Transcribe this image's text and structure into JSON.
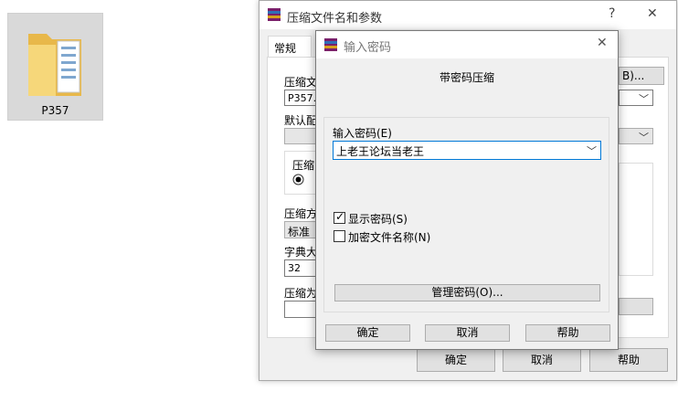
{
  "desktop": {
    "folder_label": "P357"
  },
  "back_dialog": {
    "title": "压缩文件名和参数",
    "help_symbol": "?",
    "close_symbol": "✕",
    "tab_general": "常规",
    "label_archive_name": "压缩文",
    "archive_name_value": "P357.r",
    "browse_button_partial": "B)...",
    "label_default_profile": "默认配",
    "label_update_partial": "压缩",
    "label_method": "压缩方",
    "method_value": "标准",
    "label_dictionary": "字典大",
    "dictionary_value": "32",
    "label_volume": "压缩为",
    "ok_button": "确定",
    "cancel_button": "取消",
    "help_button": "帮助"
  },
  "front_dialog": {
    "title": "输入密码",
    "close_symbol": "✕",
    "heading": "带密码压缩",
    "label_enter_password": "输入密码(E)",
    "password_value": "上老王论坛当老王",
    "show_password_label": "显示密码(S)",
    "show_password_checked": true,
    "encrypt_names_label": "加密文件名称(N)",
    "encrypt_names_checked": false,
    "manage_passwords_button": "管理密码(O)...",
    "ok_button": "确定",
    "cancel_button": "取消",
    "help_button": "帮助"
  }
}
